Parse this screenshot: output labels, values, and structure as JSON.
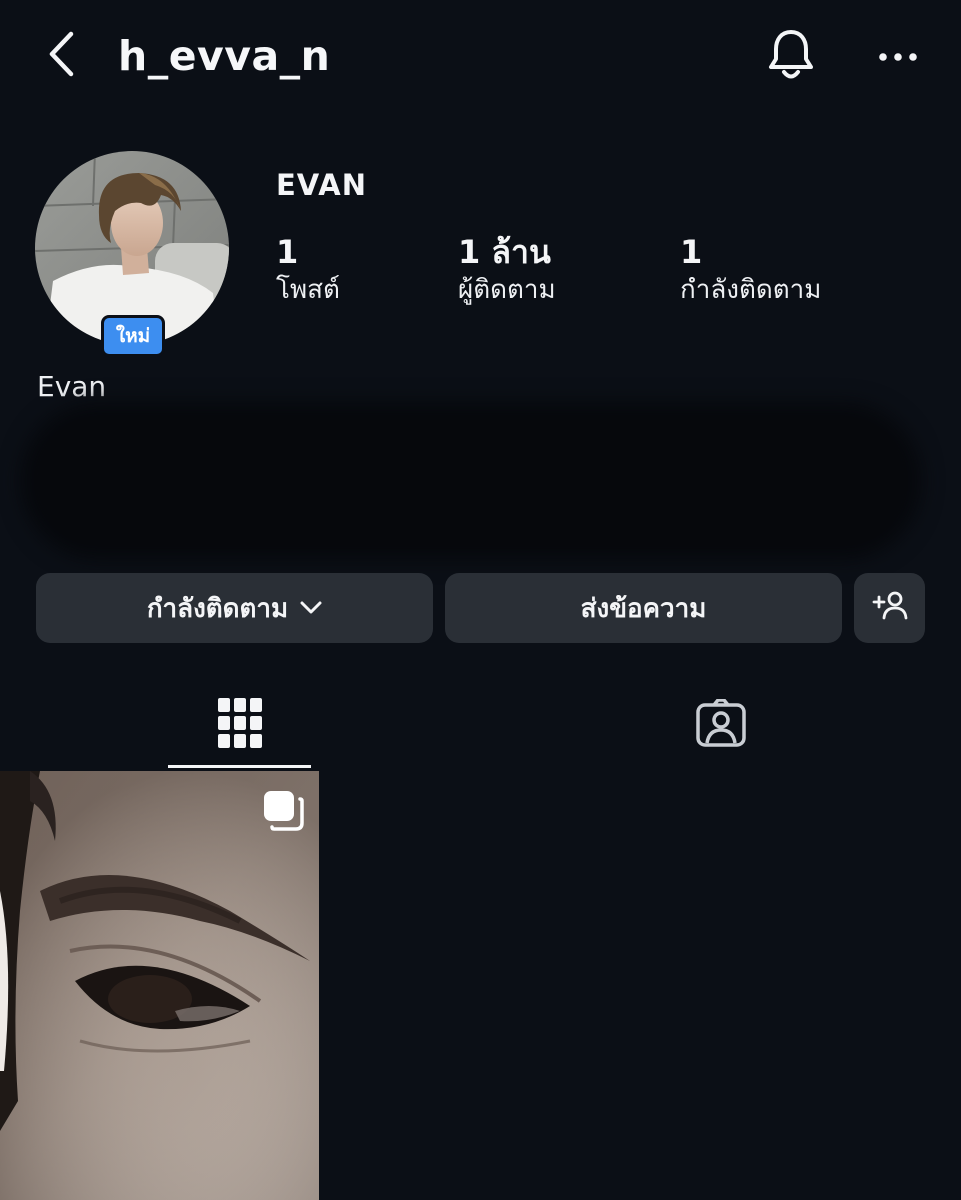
{
  "header": {
    "username": "h_evva_n",
    "back_icon": "chevron-left-icon",
    "bell_icon": "bell-icon",
    "more_icon": "more-horizontal-icon"
  },
  "profile": {
    "display_name": "EVAN",
    "new_badge": "ใหม่",
    "full_name": "Evan",
    "stats": {
      "posts_count": "1",
      "posts_label": "โพสต์",
      "followers_count": "1 ล้าน",
      "followers_label": "ผู้ติดตาม",
      "following_count": "1",
      "following_label": "กำลังติดตาม"
    }
  },
  "actions": {
    "following_label": "กำลังติดตาม",
    "message_label": "ส่งข้อความ",
    "add_person_icon": "add-person-icon"
  },
  "tabs": {
    "grid_icon": "grid-icon",
    "tagged_icon": "tagged-icon",
    "active": "grid"
  },
  "posts": [
    {
      "type": "carousel",
      "icon": "multiple-posts-icon"
    }
  ],
  "colors": {
    "background": "#0b0f16",
    "button": "#2a2f36",
    "badge": "#3d8ef0",
    "text": "#f4f5f7"
  }
}
